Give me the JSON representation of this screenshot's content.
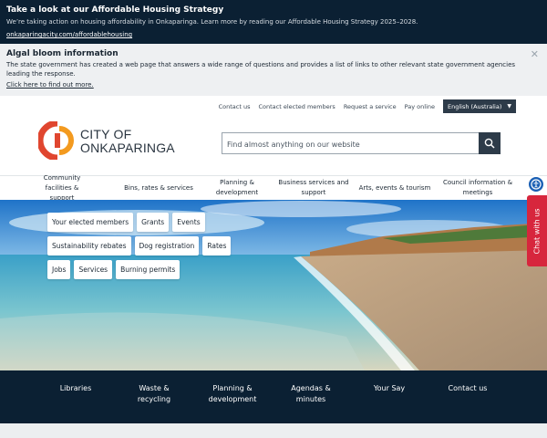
{
  "alerts": [
    {
      "title": "Take a look at our Affordable Housing Strategy",
      "body": "We’re taking action on housing affordability in Onkaparinga. Learn more by reading our Affordable Housing Strategy 2025–2028.",
      "link": "onkaparingacity.com/affordablehousing"
    },
    {
      "title": "Algal bloom information",
      "body": "The state government has created a web page that answers a wide range of questions and provides a list of links to other relevant state government agencies leading the response.",
      "link": "Click here to find out more.",
      "close": "✕"
    }
  ],
  "utility": {
    "links": [
      "Contact us",
      "Contact elected members",
      "Request a service",
      "Pay online"
    ],
    "language": "English (Australia)",
    "caret": "▼"
  },
  "logo": {
    "line1": "CITY OF",
    "line2": "ONKAPARINGA"
  },
  "search": {
    "placeholder": "Find almost anything on our website"
  },
  "nav": [
    {
      "label": "Community facilities & support"
    },
    {
      "label": "Bins, rates & services"
    },
    {
      "label": "Planning & development"
    },
    {
      "label": "Business services and support"
    },
    {
      "label": "Arts, events & tourism"
    },
    {
      "label": "Council information & meetings"
    }
  ],
  "quick_links": [
    [
      "Your elected members",
      "Grants",
      "Events"
    ],
    [
      "Sustainability rebates",
      "Dog registration",
      "Rates"
    ],
    [
      "Jobs",
      "Services",
      "Burning permits"
    ]
  ],
  "chat": {
    "label": "Chat with us"
  },
  "footer_links": [
    "Libraries",
    "Waste & recycling",
    "Planning & development",
    "Agendas & minutes",
    "Your Say",
    "Contact us"
  ],
  "colors": {
    "navy": "#0b2033",
    "logo_red": "#e0462f",
    "logo_orange": "#f39a1f",
    "chat_red": "#d7263d"
  }
}
